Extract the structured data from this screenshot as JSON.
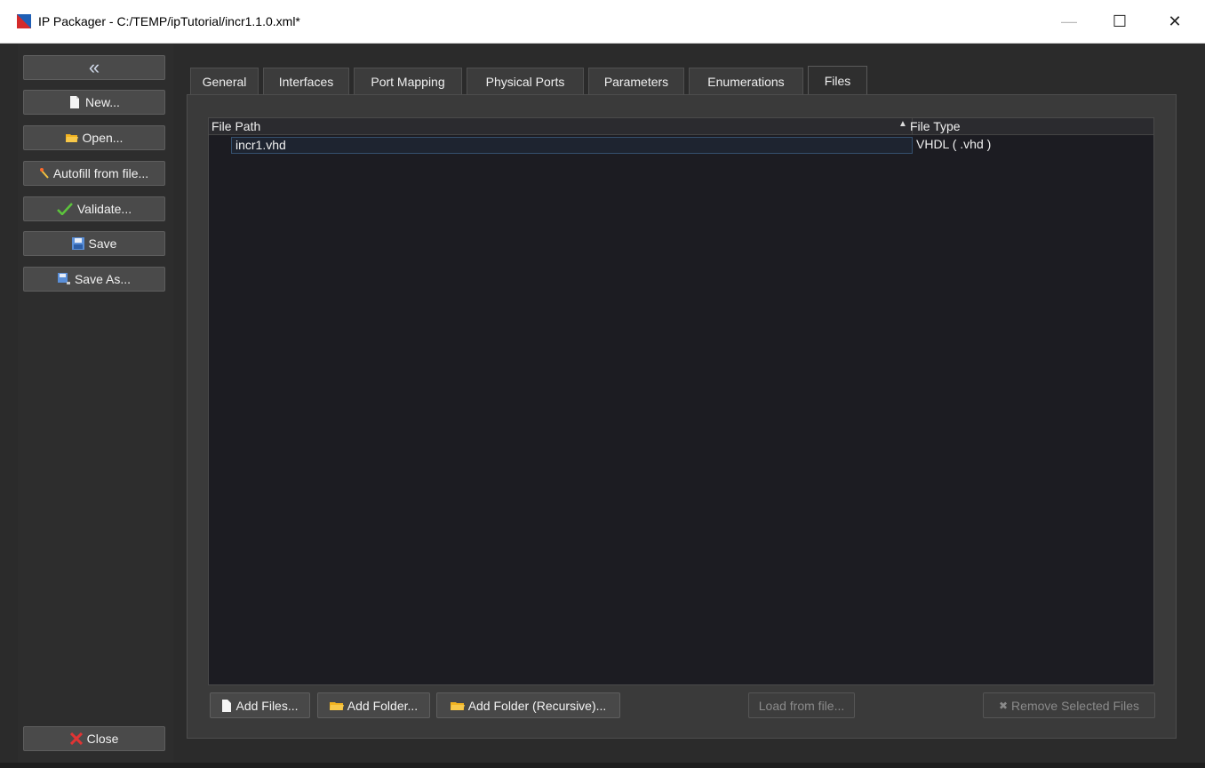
{
  "window": {
    "title": "IP Packager - C:/TEMP/ipTutorial/incr1.1.0.xml*",
    "controls": {
      "minimize": "—",
      "maximize": "☐",
      "close": "✕"
    }
  },
  "sidebar": {
    "collapse_label": "«",
    "new_label": "New...",
    "open_label": "Open...",
    "autofill_label": "Autofill from file...",
    "validate_label": "Validate...",
    "save_label": "Save",
    "save_as_label": "Save As...",
    "close_label": "Close"
  },
  "tabs": [
    {
      "label": "General"
    },
    {
      "label": "Interfaces"
    },
    {
      "label": "Port Mapping"
    },
    {
      "label": "Physical Ports"
    },
    {
      "label": "Parameters"
    },
    {
      "label": "Enumerations"
    },
    {
      "label": "Files"
    }
  ],
  "active_tab": "Files",
  "files_table": {
    "columns": {
      "path": "File Path",
      "type": "File Type",
      "sort_indicator": "▲"
    },
    "rows": [
      {
        "path": "incr1.vhd",
        "type": "VHDL ( .vhd )"
      }
    ]
  },
  "file_buttons": {
    "add_files": "Add Files...",
    "add_folder": "Add Folder...",
    "add_folder_recursive": "Add Folder (Recursive)...",
    "load_from_file": "Load from file...",
    "remove_selected": "Remove Selected Files"
  },
  "colors": {
    "background": "#2b2b2b",
    "table_bg": "#1c1c22",
    "button_bg": "#4a4a4a",
    "folder_icon": "#f2b320",
    "check_icon": "#5cc43c",
    "close_icon": "#e03434"
  }
}
